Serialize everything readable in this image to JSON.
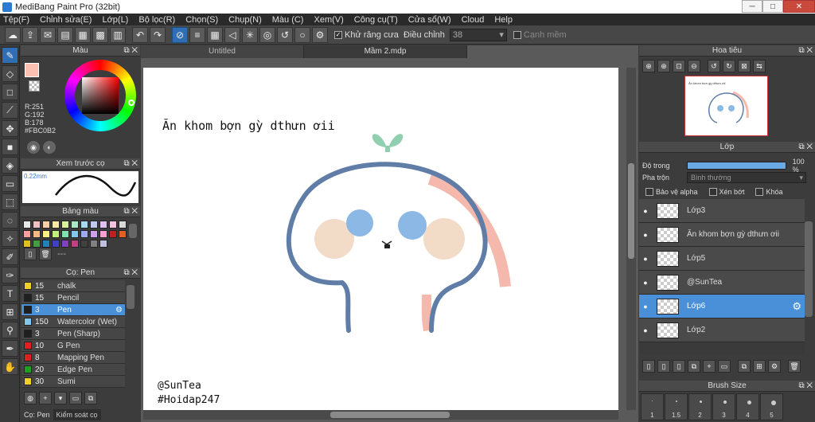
{
  "window": {
    "title": "MediBang Paint Pro (32bit)"
  },
  "menu": [
    "Tệp(F)",
    "Chỉnh sửa(E)",
    "Lớp(L)",
    "Bộ lọc(R)",
    "Chọn(S)",
    "Chụp(N)",
    "Màu (C)",
    "Xem(V)",
    "Công cụ(T)",
    "Cửa sổ(W)",
    "Cloud",
    "Help"
  ],
  "toolbar": {
    "antialias_label": "Khử răng cưa",
    "adjust_label": "Điều chỉnh",
    "adjust_value": "38",
    "smooth_label": "Cạnh mềm"
  },
  "color_panel": {
    "title": "Màu",
    "r": "R:251",
    "g": "G:192",
    "b": "B:178",
    "hex": "#FBC0B2",
    "fg": "#FBC0B2",
    "accent": "#e04040"
  },
  "brush_preview": {
    "title": "Xem trước cọ",
    "size": "0.22mm"
  },
  "palette": {
    "title": "Bảng màu",
    "colors": [
      "#e8e8e8",
      "#f0c0c0",
      "#f8d0a8",
      "#f8e8a0",
      "#d8f0a0",
      "#a8e8c8",
      "#a8d8f0",
      "#c0c8f0",
      "#e0c0f0",
      "#f8c0e0",
      "#d8d8d8",
      "#f8a0a0",
      "#f8b880",
      "#f8f080",
      "#c0f080",
      "#80e0b0",
      "#80c8f0",
      "#a0a8f0",
      "#d0a0f0",
      "#f8a0d0",
      "#c02020",
      "#e06020",
      "#e0c020",
      "#40a040",
      "#2080c0",
      "#4040c0",
      "#8040c0",
      "#c04080",
      "#404040",
      "#808080",
      "#c0c0e0"
    ],
    "dash": "---"
  },
  "brush_panel": {
    "title": "Cọ: Pen",
    "items": [
      {
        "size": "15",
        "name": "chalk",
        "color": "#f0d020"
      },
      {
        "size": "15",
        "name": "Pencil",
        "color": "#202020"
      },
      {
        "size": "3",
        "name": "Pen",
        "color": "#202020"
      },
      {
        "size": "150",
        "name": "Watercolor (Wet)",
        "color": "#80c8f0"
      },
      {
        "size": "3",
        "name": "Pen (Sharp)",
        "color": "#202020"
      },
      {
        "size": "10",
        "name": "G Pen",
        "color": "#e02020"
      },
      {
        "size": "8",
        "name": "Mapping Pen",
        "color": "#e02020"
      },
      {
        "size": "20",
        "name": "Edge Pen",
        "color": "#20a020"
      },
      {
        "size": "30",
        "name": "Sumi",
        "color": "#f0d020"
      }
    ],
    "bottom_tabs": [
      "Cọ: Pen",
      "Kiểm soát cọ"
    ]
  },
  "canvas": {
    "tabs": [
      "Untitled",
      "Mầm 2.mdp"
    ],
    "caption_top": "Ăn khom bợn gỳ dthưn ơii",
    "caption_bottom_1": "@SunTea",
    "caption_bottom_2": "#Hoidap247"
  },
  "navigator": {
    "title": "Hoa tiêu",
    "preview_text": "Ăn khom bợn gỳ dthưn ơii"
  },
  "layer_panel": {
    "title": "Lớp",
    "opacity_label": "Độ trong",
    "opacity_value": "100 %",
    "opacity": 1.0,
    "blend_label": "Pha trộn",
    "blend_value": "Bình thường",
    "protect_alpha": "Bảo vệ alpha",
    "clipping": "Xén bớt",
    "lock": "Khóa",
    "layers": [
      {
        "name": "Lớp3"
      },
      {
        "name": "Ăn khom bợn gỳ dthưn ơii"
      },
      {
        "name": "Lớp5"
      },
      {
        "name": "@SunTea"
      },
      {
        "name": "Lớp6"
      },
      {
        "name": "Lớp2"
      }
    ]
  },
  "brush_size_panel": {
    "title": "Brush Size",
    "sizes": [
      "1",
      "1.5",
      "2",
      "3",
      "4",
      "5"
    ]
  }
}
